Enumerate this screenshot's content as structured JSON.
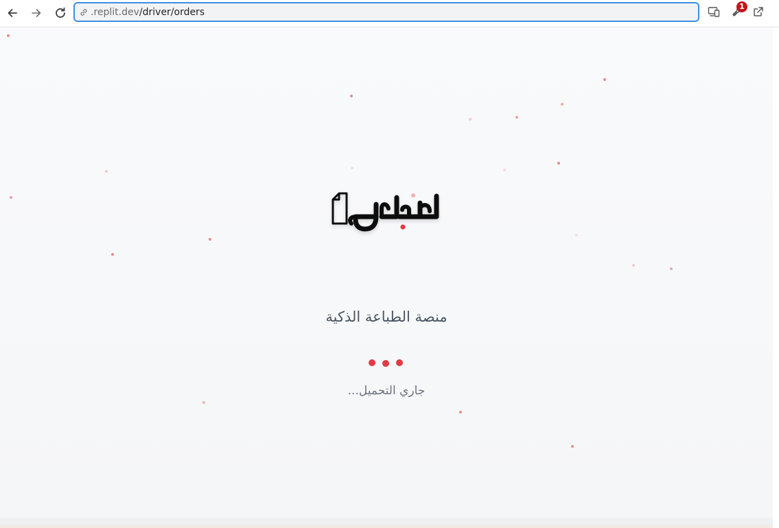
{
  "browser": {
    "url_prefix": ".replit.dev",
    "url_path": "/driver/orders",
    "notification_count": "1",
    "icons": {
      "back": "arrow-left-icon",
      "forward": "arrow-right-icon",
      "reload": "reload-icon",
      "url": "link-icon",
      "devices": "responsive-devices-icon",
      "tools": "wrench-icon",
      "open_external": "external-link-icon"
    }
  },
  "app": {
    "logo_text": "اطبعلي",
    "tagline": "منصة الطباعة الذكية",
    "loading_text": "جاري التحميل...",
    "colors": {
      "accent": "#e53945",
      "logo": "#111111",
      "tagline": "#4b5563",
      "loading_text": "#6b7280"
    }
  }
}
